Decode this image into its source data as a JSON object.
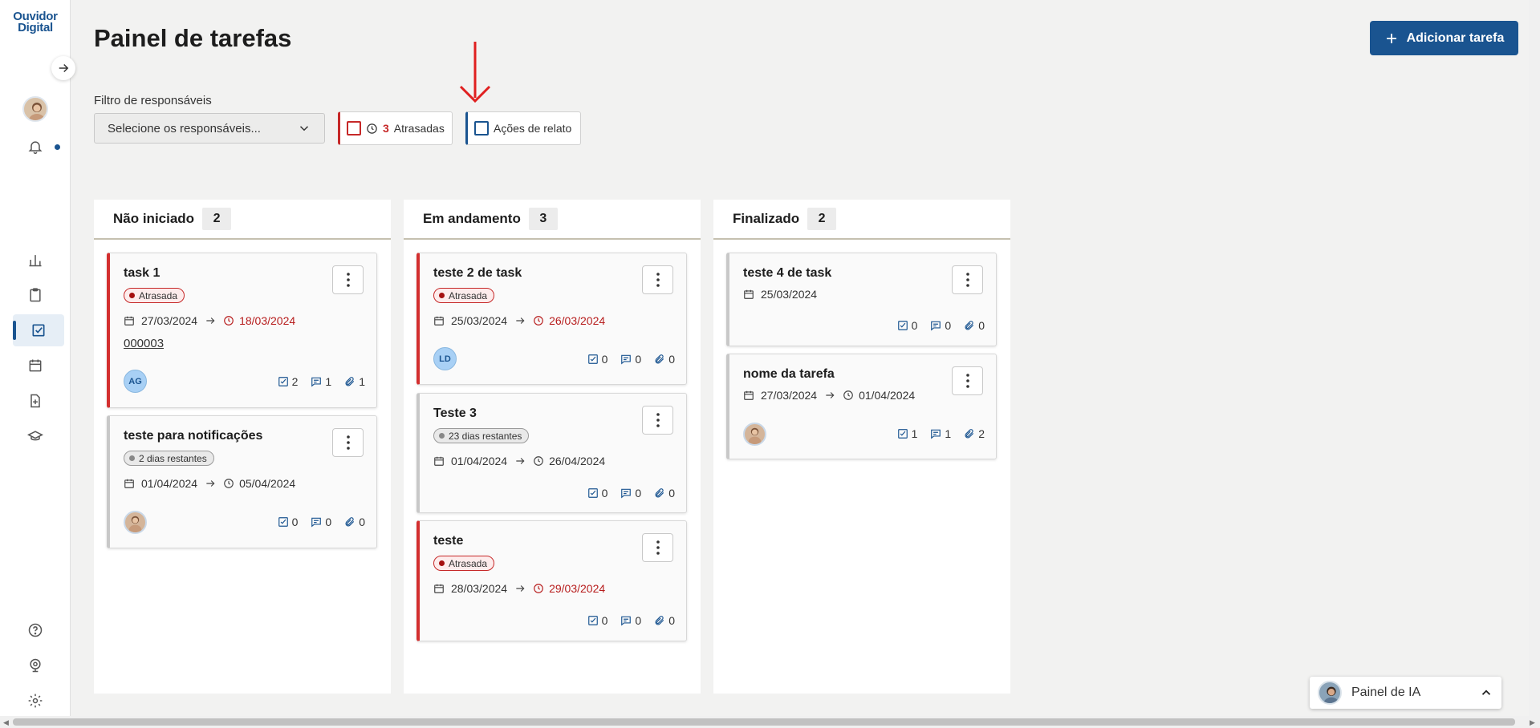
{
  "sidebar": {
    "logo_line1": "Ouvidor",
    "logo_line2": "Digital",
    "icons": [
      "arrow-right-icon",
      "avatar",
      "bell-icon",
      "chart-icon",
      "clipboard-icon",
      "task-check-icon",
      "calendar-icon",
      "file-plus-icon",
      "graduation-cap-icon",
      "help-icon",
      "webcam-icon",
      "gear-icon"
    ]
  },
  "header": {
    "title": "Painel de tarefas",
    "add_button": "Adicionar tarefa"
  },
  "filters": {
    "label": "Filtro de responsáveis",
    "placeholder": "Selecione os responsáveis...",
    "late_count": "3",
    "late_label": "Atrasadas",
    "relato_label": "Ações de relato"
  },
  "columns": [
    {
      "title": "Não iniciado",
      "count": "2",
      "cards": [
        {
          "title": "task 1",
          "badge": "Atrasada",
          "start": "27/03/2024",
          "due": "18/03/2024",
          "ref": "000003",
          "assignee": "AG",
          "checks": "2",
          "comments": "1",
          "attachments": "1"
        },
        {
          "title": "teste para notificações",
          "badge": "2 dias restantes",
          "start": "01/04/2024",
          "due": "05/04/2024",
          "checks": "0",
          "comments": "0",
          "attachments": "0"
        }
      ]
    },
    {
      "title": "Em andamento",
      "count": "3",
      "cards": [
        {
          "title": "teste 2 de task",
          "badge": "Atrasada",
          "start": "25/03/2024",
          "due": "26/03/2024",
          "assignee": "LD",
          "checks": "0",
          "comments": "0",
          "attachments": "0"
        },
        {
          "title": "Teste 3",
          "badge": "23 dias restantes",
          "start": "01/04/2024",
          "due": "26/04/2024",
          "checks": "0",
          "comments": "0",
          "attachments": "0"
        },
        {
          "title": "teste",
          "badge": "Atrasada",
          "start": "28/03/2024",
          "due": "29/03/2024",
          "checks": "0",
          "comments": "0",
          "attachments": "0"
        }
      ]
    },
    {
      "title": "Finalizado",
      "count": "2",
      "cards": [
        {
          "title": "teste 4 de task",
          "start": "25/03/2024",
          "checks": "0",
          "comments": "0",
          "attachments": "0"
        },
        {
          "title": "nome da tarefa",
          "start": "27/03/2024",
          "due": "01/04/2024",
          "checks": "1",
          "comments": "1",
          "attachments": "2"
        }
      ]
    }
  ],
  "ia_panel": {
    "label": "Painel de IA"
  },
  "colors": {
    "primary": "#1a5490",
    "late": "#c62828",
    "background": "#f2f2f1"
  }
}
